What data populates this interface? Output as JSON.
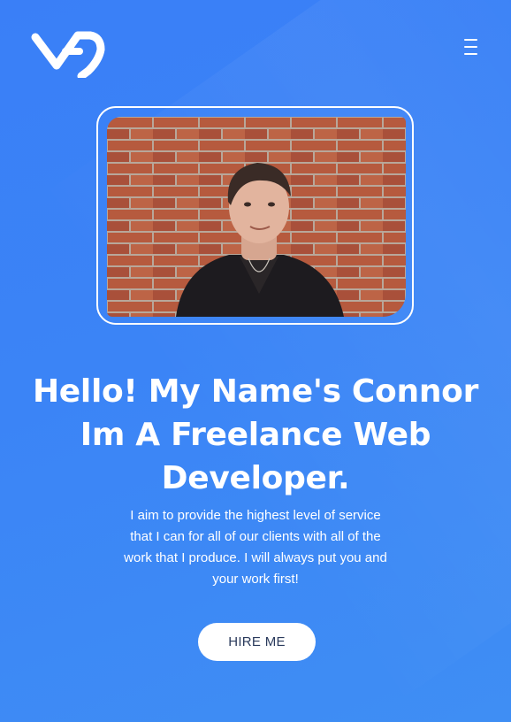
{
  "brand": {
    "logo_icon": "vp-monogram-logo"
  },
  "nav": {
    "menu_icon": "hamburger-menu-icon"
  },
  "hero": {
    "photo_alt": "Portrait of Connor in front of a brick wall",
    "headline_lines": [
      "Hello! My Name's Connor",
      "Im A Freelance Web",
      "Developer."
    ],
    "tagline": "I aim to provide the highest level of service that I can for all of our clients with all of the work that I produce. I will always put you and your work first!",
    "cta_label": "HIRE ME"
  },
  "colors": {
    "background": "#3b84f6",
    "text": "#ffffff",
    "button_bg": "#ffffff",
    "button_text": "#2a3a5c"
  }
}
